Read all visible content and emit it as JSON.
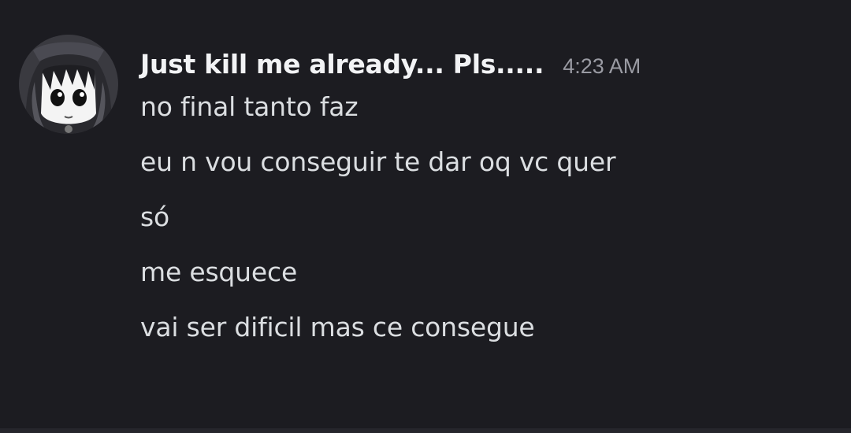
{
  "message_group": {
    "author": {
      "username": "Just kill me already... Pls.....",
      "avatar_icon": "hooded-anime-character-avatar"
    },
    "timestamp": "4:23 AM",
    "messages": [
      "no final tanto faz",
      "eu n vou conseguir te dar oq vc quer",
      "só",
      "me esquece",
      "vai ser dificil mas ce consegue"
    ]
  },
  "theme": {
    "background": "#1c1c21",
    "username_color": "#f2f3f5",
    "message_color": "#dbdee1",
    "timestamp_color": "#9a9ba3"
  }
}
